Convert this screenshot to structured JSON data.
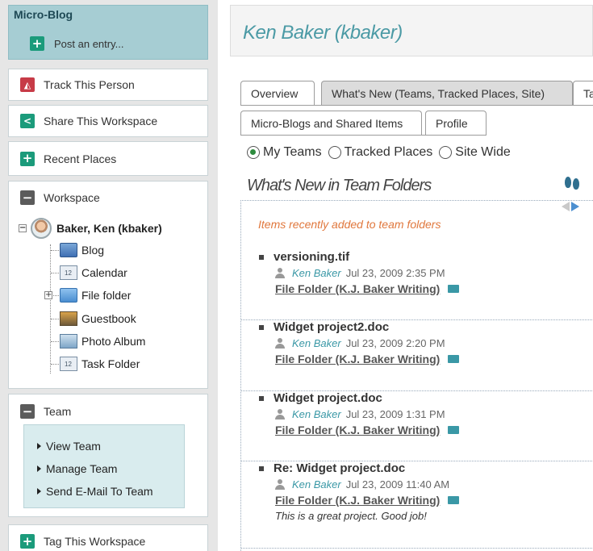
{
  "sidebar": {
    "microblog": {
      "title": "Micro-Blog",
      "post_label": "Post an entry..."
    },
    "track_label": "Track This Person",
    "share_label": "Share This Workspace",
    "recent_label": "Recent Places",
    "workspace": {
      "title": "Workspace",
      "user": "Baker, Ken (kbaker)",
      "folders": [
        "Blog",
        "Calendar",
        "File folder",
        "Guestbook",
        "Photo Album",
        "Task Folder"
      ]
    },
    "team": {
      "title": "Team",
      "links": [
        "View Team",
        "Manage Team",
        "Send E-Mail To Team"
      ]
    },
    "tag_label": "Tag This Workspace"
  },
  "main": {
    "title": "Ken Baker (kbaker)",
    "tabs": [
      "Overview",
      "What's New (Teams, Tracked Places, Site)",
      "Ta",
      "Micro-Blogs and Shared Items",
      "Profile"
    ],
    "filters": [
      "My Teams",
      "Tracked Places",
      "Site Wide"
    ],
    "section_title": "What's New in Team Folders",
    "feed_note": "Items recently added to team folders",
    "entries": [
      {
        "title": "versioning.tif",
        "author": "Ken Baker",
        "date": "Jul 23, 2009 2:35 PM",
        "folder": "File Folder (K.J. Baker Writing)",
        "comment": ""
      },
      {
        "title": "Widget project2.doc",
        "author": "Ken Baker",
        "date": "Jul 23, 2009 2:20 PM",
        "folder": "File Folder (K.J. Baker Writing)",
        "comment": ""
      },
      {
        "title": "Widget project.doc",
        "author": "Ken Baker",
        "date": "Jul 23, 2009 1:31 PM",
        "folder": "File Folder (K.J. Baker Writing)",
        "comment": ""
      },
      {
        "title": "Re: Widget project.doc",
        "author": "Ken Baker",
        "date": "Jul 23, 2009 11:40 AM",
        "folder": "File Folder (K.J. Baker Writing)",
        "comment": "This is a great project. Good job!"
      }
    ]
  },
  "colors": {
    "accent_teal": "#3a98a6",
    "microblog_bg": "#a6cdd3",
    "note_orange": "#e0773c",
    "icon_green": "#1b9b7b",
    "icon_red": "#c73b47"
  },
  "icons": [
    "plus-icon",
    "track-person-icon",
    "share-icon",
    "minus-icon",
    "avatar",
    "folder-icon",
    "calendar-icon",
    "guestbook-icon",
    "photo-album-icon",
    "task-folder-icon",
    "person-icon",
    "footprints-icon",
    "arrow-left-icon",
    "arrow-right-icon"
  ]
}
